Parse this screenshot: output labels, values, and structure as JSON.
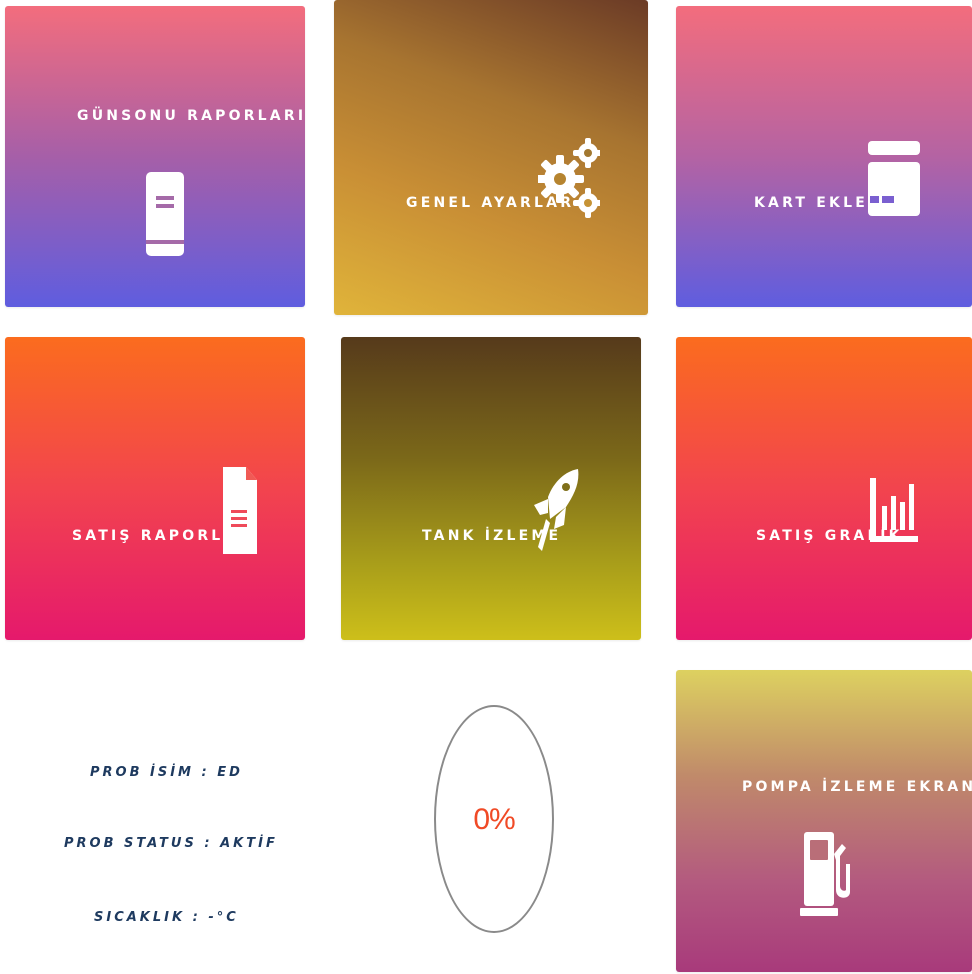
{
  "tiles": {
    "gunsonu": {
      "label": "GÜNSONU RAPORLARI",
      "icon": "book-icon"
    },
    "genel": {
      "label": "GENEL AYARLAR",
      "icon": "gears-icon"
    },
    "kart": {
      "label": "KART EKLEME",
      "icon": "credit-card-icon"
    },
    "satis_rapor": {
      "label": "SATIŞ RAPORLARI",
      "icon": "document-icon"
    },
    "tank": {
      "label": "TANK İZLEME",
      "icon": "rocket-icon"
    },
    "satis_grafik": {
      "label": "SATIŞ GRAFİK",
      "icon": "bar-chart-icon"
    },
    "pompa": {
      "label": "POMPA İZLEME EKRANI",
      "icon": "fuel-pump-icon"
    }
  },
  "probe": {
    "name_line": "PROB İSİM : ED",
    "status_line": "PROB STATUS : AKTİF",
    "temp_line": "SICAKLIK : -°C"
  },
  "gauge": {
    "value": "0%",
    "value_color": "#f04a26"
  },
  "colors": {
    "info_text": "#1e3a5f",
    "tile_text": "#ffffff"
  }
}
